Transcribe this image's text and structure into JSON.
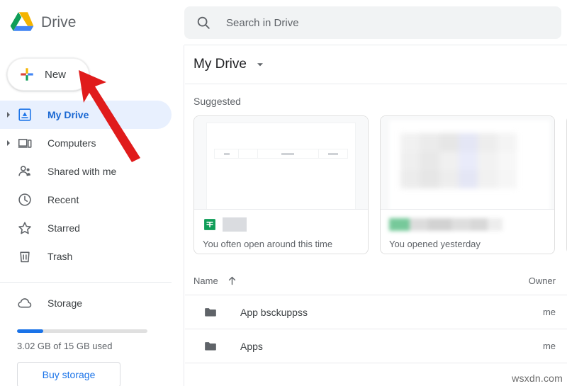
{
  "app": {
    "brand_name": "Drive",
    "logo_icon": "google-drive-logo",
    "colors": {
      "accent_blue": "#1a73e8",
      "active_pill": "#e8f0fe",
      "active_text": "#1967d2",
      "text_primary": "#202124",
      "text_secondary": "#5f6368",
      "search_bg": "#f1f3f4",
      "border": "#e8eaed",
      "annotation_red": "#e01b1b",
      "sheets_green": "#0f9d58",
      "folder_gray": "#5f6368"
    }
  },
  "search": {
    "icon": "search-icon",
    "placeholder": "Search in Drive",
    "value": ""
  },
  "sidebar": {
    "new_button": {
      "label": "New",
      "icon": "google-plus-multicolor-icon"
    },
    "items": [
      {
        "label": "My Drive",
        "icon": "my-drive-icon",
        "caret": true,
        "active": true
      },
      {
        "label": "Computers",
        "icon": "computer-icon",
        "caret": true,
        "active": false
      },
      {
        "label": "Shared with me",
        "icon": "people-icon",
        "caret": false,
        "active": false
      },
      {
        "label": "Recent",
        "icon": "clock-icon",
        "caret": false,
        "active": false
      },
      {
        "label": "Starred",
        "icon": "star-outline-icon",
        "caret": false,
        "active": false
      },
      {
        "label": "Trash",
        "icon": "trash-icon",
        "caret": false,
        "active": false
      }
    ],
    "storage": {
      "icon": "cloud-icon",
      "label": "Storage",
      "used_text": "3.02 GB of 15 GB used",
      "percent": 20,
      "buy_label": "Buy storage"
    }
  },
  "main": {
    "breadcrumb": {
      "title": "My Drive",
      "caret_icon": "chevron-down-icon"
    },
    "suggested": {
      "heading": "Suggested",
      "cards": [
        {
          "thumb": "spreadsheet-preview",
          "file_icon": "google-sheets-icon",
          "title": "",
          "title_redacted": true,
          "subtitle": "You often open around this time"
        },
        {
          "thumb": "blurred-preview",
          "file_icon": "google-sheets-icon",
          "title": "",
          "title_redacted": true,
          "subtitle": "You opened yesterday"
        },
        {
          "thumb": "blurred-preview",
          "file_icon": "google-sheets-icon",
          "title": "",
          "title_redacted": true,
          "subtitle": ""
        }
      ]
    },
    "file_list": {
      "columns": {
        "name": "Name",
        "sort_icon": "arrow-up-icon",
        "owner": "Owner"
      },
      "rows": [
        {
          "icon": "folder-icon",
          "name": "App bsckuppss",
          "owner": "me"
        },
        {
          "icon": "folder-icon",
          "name": "Apps",
          "owner": "me"
        }
      ]
    }
  },
  "annotation": {
    "type": "red-arrow",
    "points_to": "New",
    "color": "#e01b1b"
  },
  "watermark": {
    "text": "wsxdn.com"
  }
}
